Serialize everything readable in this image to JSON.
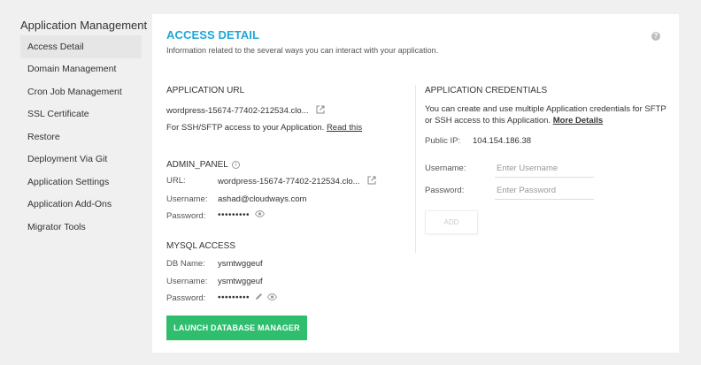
{
  "sidebar": {
    "title": "Application Management",
    "items": [
      {
        "label": "Access Detail",
        "active": true
      },
      {
        "label": "Domain Management"
      },
      {
        "label": "Cron Job Management"
      },
      {
        "label": "SSL Certificate"
      },
      {
        "label": "Restore"
      },
      {
        "label": "Deployment Via Git"
      },
      {
        "label": "Application Settings"
      },
      {
        "label": "Application Add-Ons"
      },
      {
        "label": "Migrator Tools"
      }
    ]
  },
  "header": {
    "title": "ACCESS DETAIL",
    "subtitle": "Information related to the several ways you can interact with your application.",
    "help_icon": "question-circle-icon"
  },
  "app_url": {
    "heading": "APPLICATION URL",
    "url": "wordpress-15674-77402-212534.clo...",
    "ssh_note": "For SSH/SFTP access to your Application.",
    "read_this": "Read this"
  },
  "admin_panel": {
    "heading": "ADMIN_PANEL",
    "url_label": "URL:",
    "url_value": "wordpress-15674-77402-212534.clo...",
    "username_label": "Username:",
    "username_value": "ashad@cloudways.com",
    "password_label": "Password:",
    "password_value": "•••••••••"
  },
  "mysql": {
    "heading": "MYSQL ACCESS",
    "db_label": "DB Name:",
    "db_value": "ysmtwggeuf",
    "username_label": "Username:",
    "username_value": "ysmtwggeuf",
    "password_label": "Password:",
    "password_value": "•••••••••",
    "launch_label": "LAUNCH DATABASE MANAGER"
  },
  "credentials": {
    "heading": "APPLICATION CREDENTIALS",
    "desc_line1": "You can create and use multiple Application credentials for SFTP",
    "desc_line2": "or SSH access to this Application.",
    "more_details": "More Details",
    "public_ip_label": "Public IP:",
    "public_ip_value": "104.154.186.38",
    "username_label": "Username:",
    "username_placeholder": "Enter Username",
    "password_label": "Password:",
    "password_placeholder": "Enter Password",
    "add_label": "ADD"
  },
  "colors": {
    "accent": "#1ea7d8",
    "launch_button": "#2fbe6e",
    "background": "#f0f0f0"
  }
}
